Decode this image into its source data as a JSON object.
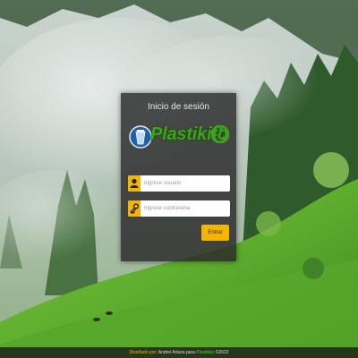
{
  "login": {
    "title": "Inicio de sesión",
    "username_placeholder": "Ingrese usuario",
    "password_placeholder": "Ingrese contraseña",
    "submit_label": "Entrar"
  },
  "logo": {
    "text": "Plastikito",
    "brand_color": "#3fa21c"
  },
  "icons": {
    "user": "user-icon",
    "password": "key-icon",
    "recycle": "recycle-icon"
  },
  "footer": {
    "prefix": "Diseñado por:",
    "author": "Andrei Arlaza",
    "middle": "para",
    "brand": "Plastikito",
    "year": "©2022"
  },
  "colors": {
    "accent": "#f5b400",
    "panel": "#282828"
  }
}
